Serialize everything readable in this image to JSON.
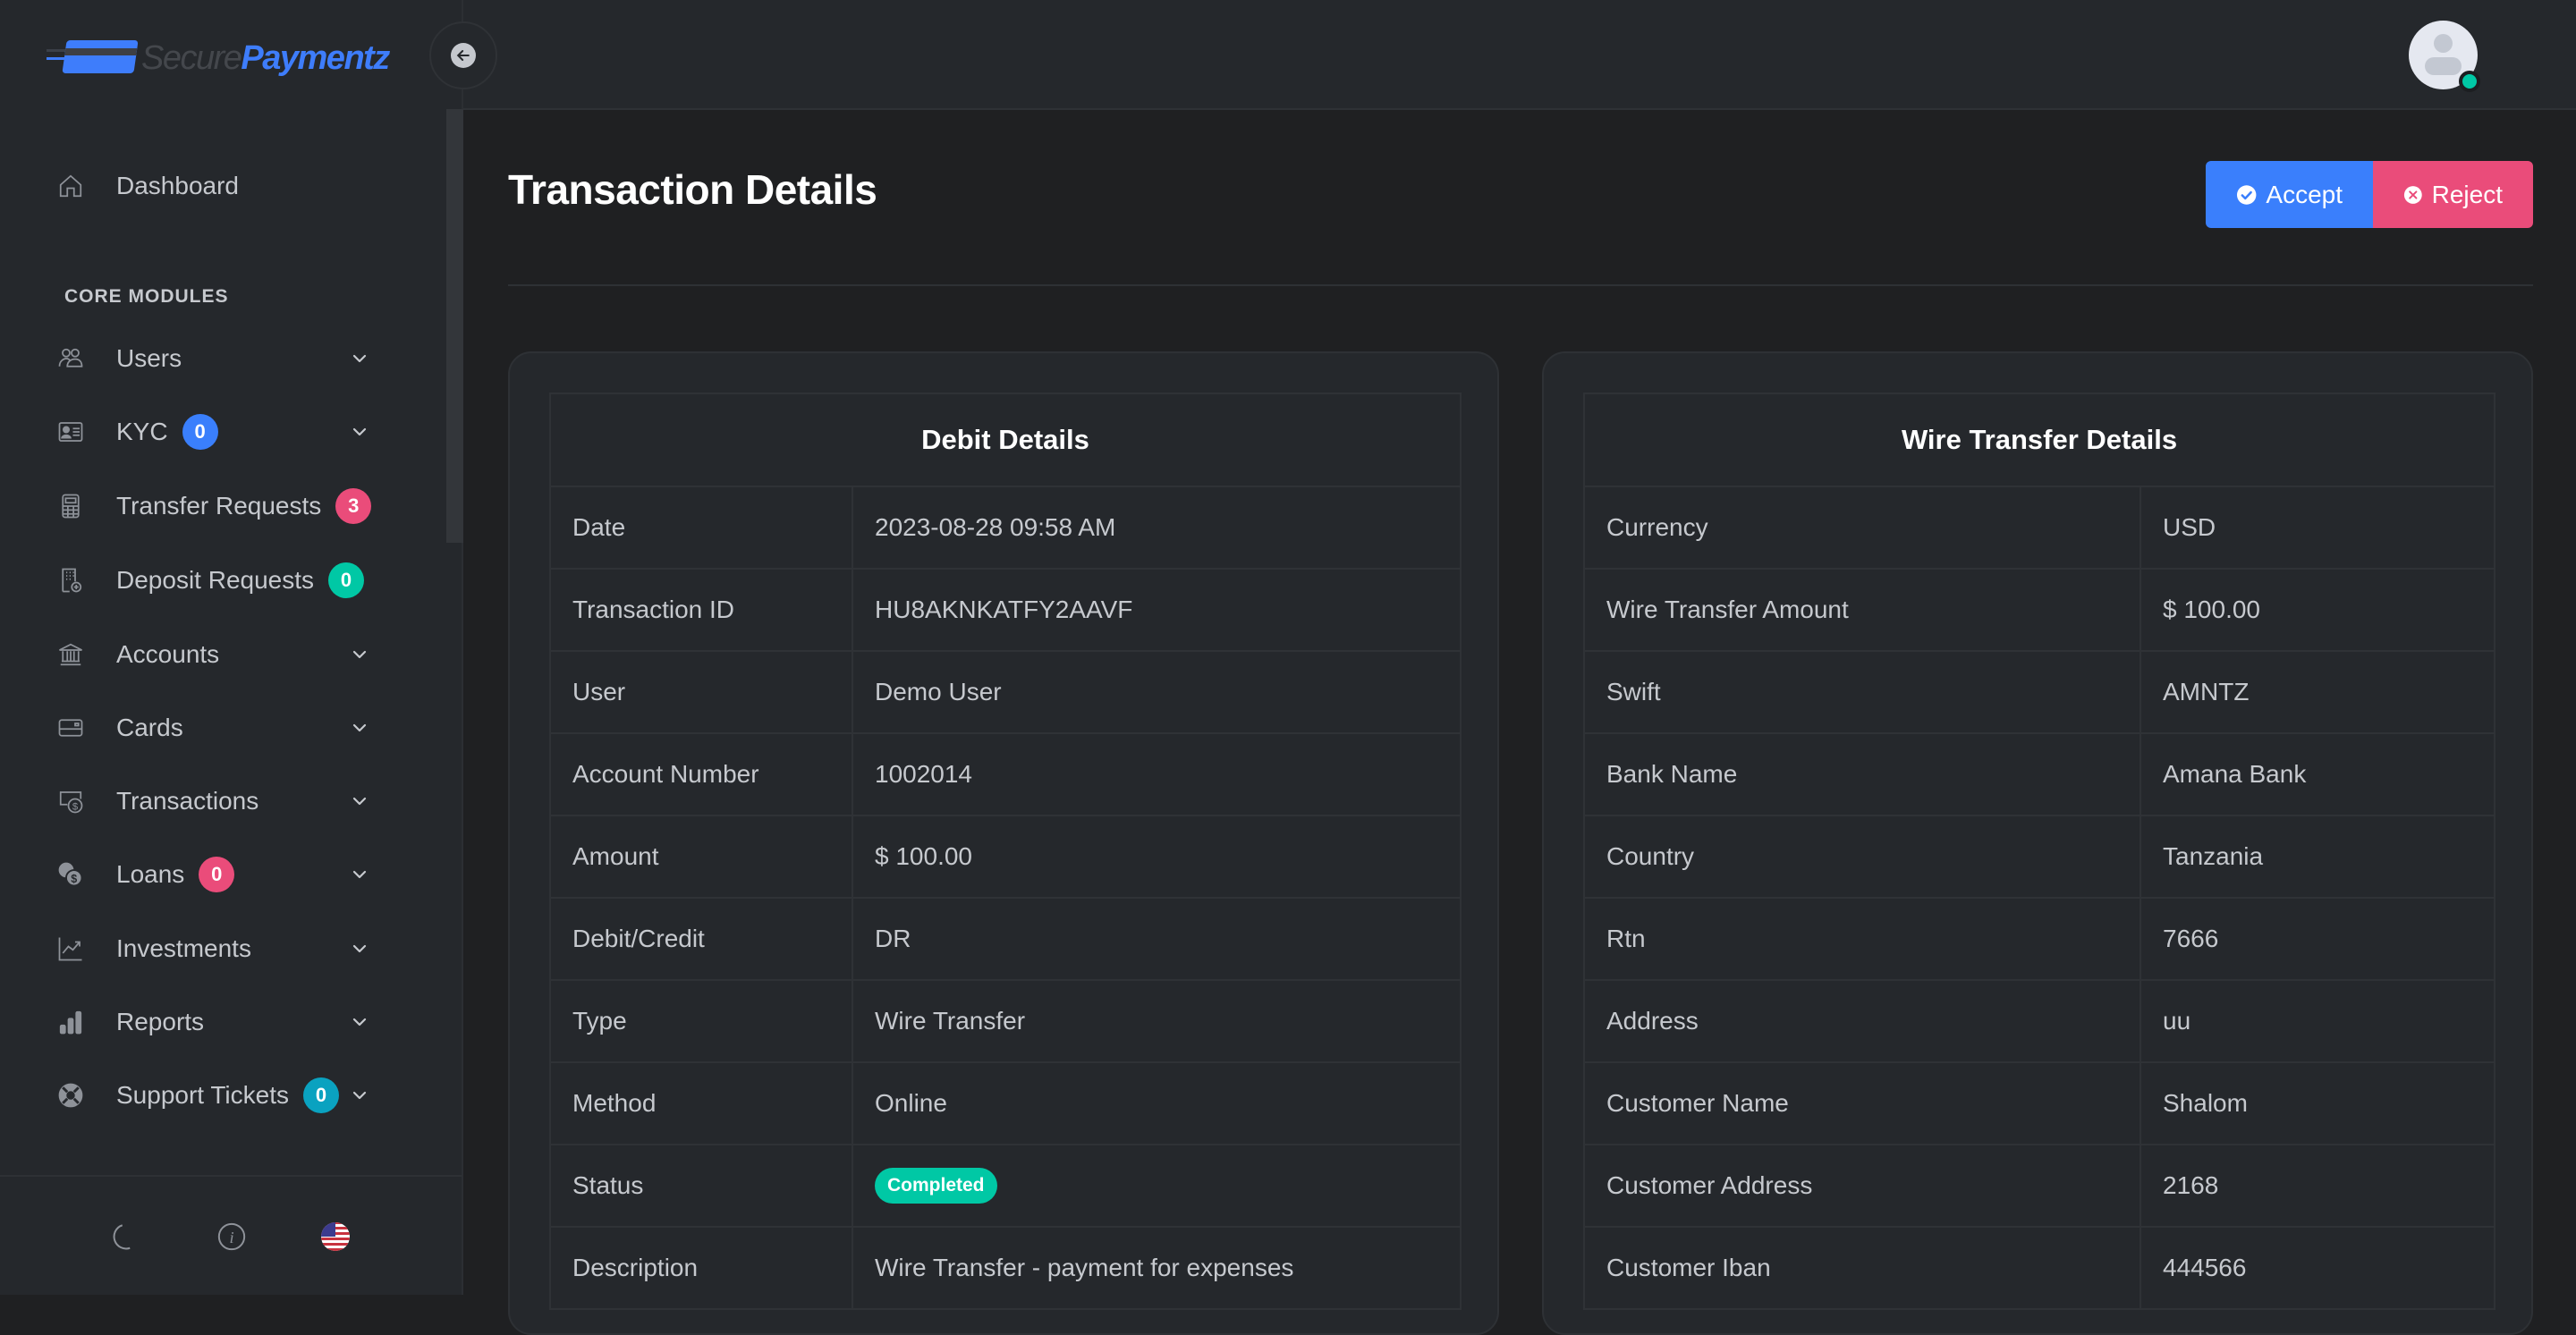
{
  "brand": {
    "part1": "Secure",
    "part2": "Paymentz"
  },
  "sidebar": {
    "dashboard": {
      "label": "Dashboard",
      "icon": "home-icon"
    },
    "section_label": "CORE MODULES",
    "items": [
      {
        "label": "Users",
        "icon": "users-icon",
        "badge": null,
        "has_chevron": true
      },
      {
        "label": "KYC",
        "icon": "id-card-icon",
        "badge": "0",
        "badge_color": "#3a7ffc",
        "has_chevron": true
      },
      {
        "label": "Transfer Requests",
        "icon": "calculator-icon",
        "badge": "3",
        "badge_color": "#ea4c7a",
        "has_chevron": false
      },
      {
        "label": "Deposit Requests",
        "icon": "building-plus-icon",
        "badge": "0",
        "badge_color": "#00c8a5",
        "has_chevron": false
      },
      {
        "label": "Accounts",
        "icon": "bank-icon",
        "badge": null,
        "has_chevron": true
      },
      {
        "label": "Cards",
        "icon": "credit-card-icon",
        "badge": null,
        "has_chevron": true
      },
      {
        "label": "Transactions",
        "icon": "cash-dollar-icon",
        "badge": null,
        "has_chevron": true
      },
      {
        "label": "Loans",
        "icon": "coins-icon",
        "badge": "0",
        "badge_color": "#ea4c7a",
        "has_chevron": true
      },
      {
        "label": "Investments",
        "icon": "chart-line-icon",
        "badge": null,
        "has_chevron": true
      },
      {
        "label": "Reports",
        "icon": "bar-chart-icon",
        "badge": null,
        "has_chevron": true
      },
      {
        "label": "Support Tickets",
        "icon": "lifebuoy-icon",
        "badge": "0",
        "badge_color": "#0aa2c0",
        "has_chevron": true
      }
    ],
    "footer": [
      "moon-icon",
      "info-icon",
      "us-flag-icon"
    ]
  },
  "header": {
    "avatar_status": "online"
  },
  "page": {
    "title": "Transaction Details",
    "accept_label": "Accept",
    "reject_label": "Reject"
  },
  "debit_details": {
    "title": "Debit Details",
    "rows": [
      {
        "key": "Date",
        "value": "2023-08-28 09:58 AM"
      },
      {
        "key": "Transaction ID",
        "value": "HU8AKNKATFY2AAVF"
      },
      {
        "key": "User",
        "value": "Demo User"
      },
      {
        "key": "Account Number",
        "value": "1002014"
      },
      {
        "key": "Amount",
        "value": "$ 100.00"
      },
      {
        "key": "Debit/Credit",
        "value": "DR"
      },
      {
        "key": "Type",
        "value": "Wire Transfer"
      },
      {
        "key": "Method",
        "value": "Online"
      },
      {
        "key": "Status",
        "value": "Completed",
        "badge": true
      },
      {
        "key": "Description",
        "value": "Wire Transfer - payment for expenses"
      }
    ]
  },
  "wire_details": {
    "title": "Wire Transfer Details",
    "rows": [
      {
        "key": "Currency",
        "value": "USD"
      },
      {
        "key": "Wire Transfer Amount",
        "value": "$ 100.00"
      },
      {
        "key": "Swift",
        "value": "AMNTZ"
      },
      {
        "key": "Bank Name",
        "value": "Amana Bank"
      },
      {
        "key": "Country",
        "value": "Tanzania"
      },
      {
        "key": "Rtn",
        "value": "7666"
      },
      {
        "key": "Address",
        "value": "uu"
      },
      {
        "key": "Customer Name",
        "value": "Shalom"
      },
      {
        "key": "Customer Address",
        "value": "2168"
      },
      {
        "key": "Customer Iban",
        "value": "444566"
      }
    ]
  },
  "colors": {
    "accent": "#3a7ffc",
    "danger": "#ea4c7a",
    "success": "#00c8a5",
    "info": "#0aa2c0"
  }
}
